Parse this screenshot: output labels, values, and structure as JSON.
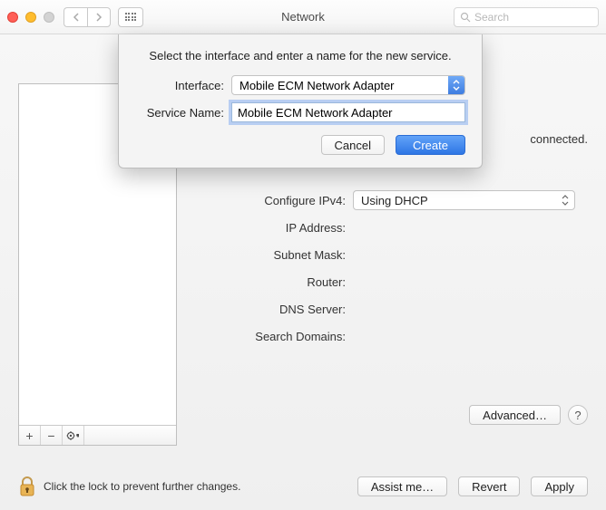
{
  "titlebar": {
    "title": "Network",
    "search_placeholder": "Search"
  },
  "status": {
    "text_suffix": "connected."
  },
  "fields": {
    "configure_ipv4": {
      "label": "Configure IPv4:",
      "value": "Using DHCP"
    },
    "ip_address": {
      "label": "IP Address:"
    },
    "subnet_mask": {
      "label": "Subnet Mask:"
    },
    "router": {
      "label": "Router:"
    },
    "dns_server": {
      "label": "DNS Server:"
    },
    "search_domains": {
      "label": "Search Domains:"
    }
  },
  "buttons": {
    "advanced": "Advanced…",
    "assist": "Assist me…",
    "revert": "Revert",
    "apply": "Apply"
  },
  "lock_text": "Click the lock to prevent further changes.",
  "sheet": {
    "message": "Select the interface and enter a name for the new service.",
    "interface_label": "Interface:",
    "interface_value": "Mobile ECM Network Adapter",
    "service_label": "Service Name:",
    "service_value": "Mobile ECM Network Adapter",
    "cancel": "Cancel",
    "create": "Create"
  }
}
